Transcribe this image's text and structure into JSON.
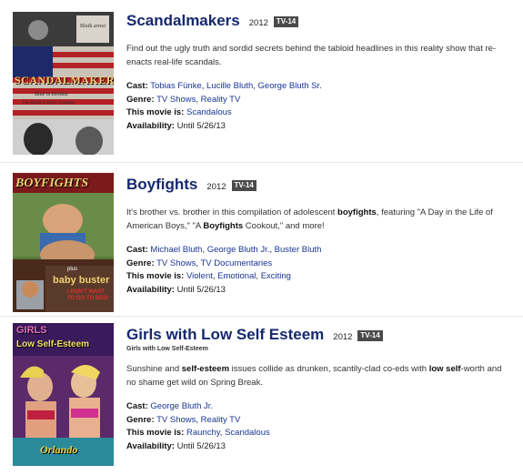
{
  "labels": {
    "cast": "Cast:",
    "genre": "Genre:",
    "mood": "This movie is:",
    "availability": "Availability:"
  },
  "items": [
    {
      "title": "Scandalmakers",
      "year": "2012",
      "rating": "TV-14",
      "poster_text": "SCANDALMAKERS",
      "poster_tagline_1": "Blue Is Brother",
      "poster_tagline_2": "The Bluth Family Scandal",
      "poster_sign": "Bluth arrest",
      "synopsis": "Find out the ugly truth and sordid secrets behind the tabloid headlines in this reality show that re-enacts real-life scandals.",
      "cast": [
        "Tobias Fünke",
        "Lucille Bluth",
        "George Bluth Sr."
      ],
      "genres": [
        "TV Shows",
        "Reality TV"
      ],
      "moods": [
        "Scandalous"
      ],
      "availability": "Until 5/26/13"
    },
    {
      "title": "Boyfights",
      "year": "2012",
      "rating": "TV-14",
      "poster_text": "BOYFIGHTS",
      "poster_small": "plus",
      "poster_bonus": "baby buster",
      "poster_note": "I DON'T WANT TO GO TO BED!",
      "synopsis_parts": [
        {
          "t": "It's brother vs. brother in this compilation of adolescent ",
          "b": false
        },
        {
          "t": "boyfights",
          "b": true
        },
        {
          "t": ", featuring \"A Day in the Life of American Boys,\" \"A ",
          "b": false
        },
        {
          "t": "Boyfights",
          "b": true
        },
        {
          "t": " Cookout,\" and more!",
          "b": false
        }
      ],
      "cast": [
        "Michael Bluth",
        "George Bluth Jr.",
        "Buster Bluth"
      ],
      "genres": [
        "TV Shows",
        "TV Documentaries"
      ],
      "moods": [
        "Violent",
        "Emotional",
        "Exciting"
      ],
      "availability": "Until 5/26/13"
    },
    {
      "title": "Girls with Low Self Esteem",
      "year": "2012",
      "rating": "TV-14",
      "subtitle": "Girls with Low Self-Esteem",
      "poster_top": "GIRLS",
      "poster_text": "Low Self-Esteem",
      "poster_bottom": "Orlando",
      "synopsis_parts": [
        {
          "t": "Sunshine and ",
          "b": false
        },
        {
          "t": "self-esteem",
          "b": true
        },
        {
          "t": " issues collide as drunken, scantily-clad co-eds with ",
          "b": false
        },
        {
          "t": "low self",
          "b": true
        },
        {
          "t": "-worth and no shame get wild on Spring Break.",
          "b": false
        }
      ],
      "cast": [
        "George Bluth Jr."
      ],
      "genres": [
        "TV Shows",
        "Reality TV"
      ],
      "moods": [
        "Raunchy",
        "Scandalous"
      ],
      "availability": "Until 5/26/13"
    }
  ]
}
